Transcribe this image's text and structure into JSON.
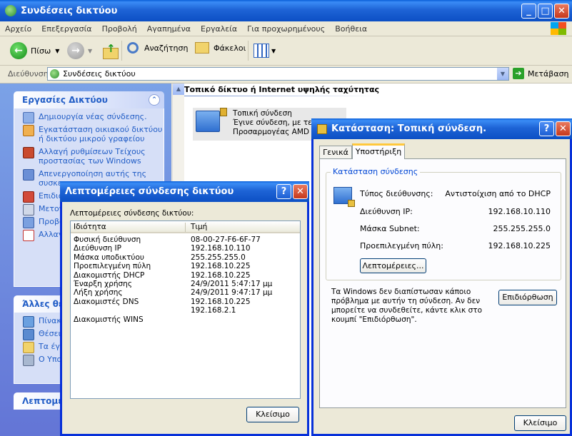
{
  "main": {
    "title": "Συνδέσεις δικτύου",
    "menu": [
      "Αρχείο",
      "Επεξεργασία",
      "Προβολή",
      "Αγαπημένα",
      "Εργαλεία",
      "Για προχωρημένους",
      "Βοήθεια"
    ],
    "toolbar": {
      "back": "Πίσω",
      "search": "Αναζήτηση",
      "folders": "Φάκελοι"
    },
    "address": {
      "label": "Διεύθυνση",
      "value": "Συνδέσεις δικτύου",
      "go": "Μετάβαση"
    }
  },
  "left": {
    "network_tasks": {
      "title": "Εργασίες Δικτύου",
      "items": [
        "Δημιουργία νέας σύνδεσης.",
        "Εγκατάσταση οικιακού δικτύου ή δικτύου μικρού γραφείου",
        "Αλλαγή ρυθμίσεων Τείχους προστασίας των Windows",
        "Απενεργοποίηση αυτής της συσκε",
        "Επιδιό σύνδε",
        "Μετον σύνδε",
        "Προβο σύνδε",
        "Αλλαγ της σύ"
      ]
    },
    "other_places": {
      "title": "Άλλες θέσ",
      "items": [
        "Πίνακ",
        "Θέσεις",
        "Τα έγγ",
        "Ο Υπολ"
      ]
    },
    "details": {
      "title": "Λεπτομέρ"
    }
  },
  "content": {
    "group_header": "Τοπικό δίκτυο ή Internet υψηλής ταχύτητας",
    "connection": {
      "name": "Τοπική σύνδεση",
      "status": "Έγινε σύνδεση, με τείχ",
      "device": "Προσαρμογέας AMD PC"
    }
  },
  "status_dialog": {
    "title": "Κατάσταση: Τοπική σύνδεση.",
    "tabs": [
      "Γενικά",
      "Υποστήριξη"
    ],
    "group_title": "Κατάσταση σύνδεσης",
    "rows": [
      {
        "label": "Τύπος διεύθυνσης:",
        "value": "Αντιστοίχιση από το DHCP"
      },
      {
        "label": "Διεύθυνση IP:",
        "value": "192.168.10.110"
      },
      {
        "label": "Μάσκα Subnet:",
        "value": "255.255.255.0"
      },
      {
        "label": "Προεπιλεγμένη πύλη:",
        "value": "192.168.10.225"
      }
    ],
    "details_button": "Λεπτομέρειες...",
    "message": "Τα Windows δεν διαπίστωσαν κάποιο πρόβλημα με αυτήν τη σύνδεση. Αν δεν μπορείτε να συνδεθείτε, κάντε κλικ στο κουμπί \"Επιδιόρθωση\".",
    "repair_button": "Επιδιόρθωση",
    "close_button": "Κλείσιμο"
  },
  "details_dialog": {
    "title": "Λεπτομέρειες σύνδεσης δικτύου",
    "label": "Λεπτομέρειες σύνδεσης δικτύου:",
    "columns": [
      "Ιδιότητα",
      "Τιμή"
    ],
    "rows": [
      {
        "prop": "Φυσική διεύθυνση",
        "value": "08-00-27-F6-6F-77"
      },
      {
        "prop": "Διεύθυνση IP",
        "value": "192.168.10.110"
      },
      {
        "prop": "Μάσκα υποδικτύου",
        "value": "255.255.255.0"
      },
      {
        "prop": "Προεπιλεγμένη πύλη",
        "value": "192.168.10.225"
      },
      {
        "prop": "Διακομιστής DHCP",
        "value": "192.168.10.225"
      },
      {
        "prop": "Έναρξη χρήσης",
        "value": "24/9/2011 5:47:17 μμ"
      },
      {
        "prop": "Λήξη χρήσης",
        "value": "24/9/2011 9:47:17 μμ"
      },
      {
        "prop": "Διακομιστές DNS",
        "value": "192.168.10.225"
      },
      {
        "prop": "",
        "value": "192.168.2.1"
      },
      {
        "prop": "Διακομιστής WINS",
        "value": ""
      }
    ],
    "close_button": "Κλείσιμο"
  }
}
